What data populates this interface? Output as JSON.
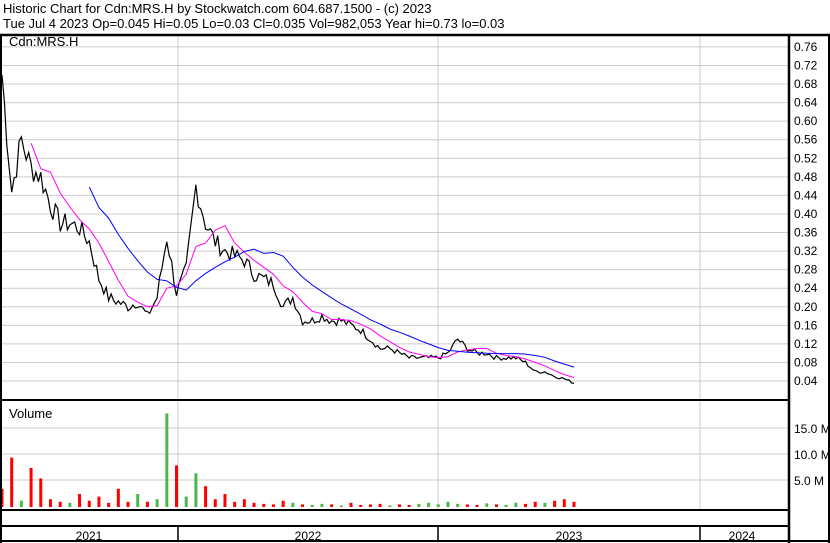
{
  "header": {
    "title": "Historic Chart for Cdn:MRS.H by Stockwatch.com 604.687.1500 - (c) 2023",
    "quote": "Tue Jul  4 2023  Op=0.045  Hi=0.05  Lo=0.03  Cl=0.035  Vol=982,053  Year hi=0.73  lo=0.03"
  },
  "chart_data": {
    "type": "line",
    "symbol": "Cdn:MRS.H",
    "price_ticks": [
      "0.76",
      "0.72",
      "0.68",
      "0.64",
      "0.60",
      "0.56",
      "0.52",
      "0.48",
      "0.44",
      "0.40",
      "0.36",
      "0.32",
      "0.28",
      "0.24",
      "0.20",
      "0.16",
      "0.12",
      "0.08",
      "0.04"
    ],
    "ylim": [
      0.02,
      0.78
    ],
    "volume_label": "Volume",
    "volume_ticks": [
      "15.0 M",
      "10.0 M",
      "5.0 M"
    ],
    "volume_ylim_millions": [
      0,
      20
    ],
    "years": [
      "2021",
      "2022",
      "2023",
      "2024"
    ],
    "closes": [
      0.7,
      0.45,
      0.56,
      0.5,
      0.48,
      0.42,
      0.38,
      0.38,
      0.37,
      0.34,
      0.26,
      0.22,
      0.21,
      0.2,
      0.21,
      0.18,
      0.22,
      0.35,
      0.23,
      0.28,
      0.46,
      0.38,
      0.34,
      0.32,
      0.31,
      0.3,
      0.27,
      0.26,
      0.25,
      0.2,
      0.22,
      0.17,
      0.17,
      0.18,
      0.17,
      0.17,
      0.16,
      0.15,
      0.13,
      0.11,
      0.11,
      0.1,
      0.09,
      0.09,
      0.09,
      0.09,
      0.1,
      0.13,
      0.11,
      0.1,
      0.1,
      0.09,
      0.09,
      0.09,
      0.08,
      0.06,
      0.06,
      0.05,
      0.045,
      0.035
    ],
    "volume_millions": [
      3.5,
      9.5,
      1.2,
      7.5,
      5.5,
      1.5,
      1.0,
      0.8,
      2.5,
      1.2,
      2.0,
      0.8,
      3.5,
      1.0,
      2.5,
      1.0,
      1.5,
      18.0,
      8.0,
      2.0,
      6.5,
      4.0,
      1.5,
      2.5,
      1.0,
      1.5,
      0.8,
      0.6,
      0.5,
      1.2,
      0.8,
      0.5,
      0.4,
      0.6,
      0.5,
      0.3,
      0.8,
      0.4,
      0.5,
      0.6,
      0.3,
      0.5,
      0.4,
      0.6,
      0.8,
      0.5,
      1.0,
      0.6,
      0.5,
      0.4,
      0.7,
      0.5,
      0.4,
      0.8,
      0.6,
      1.0,
      0.8,
      1.2,
      1.5,
      1.0
    ],
    "up_color": "#4cb84c",
    "down_color": "#ff0000",
    "short_ma_color": "#ff00ff",
    "long_ma_color": "#0000ff"
  }
}
